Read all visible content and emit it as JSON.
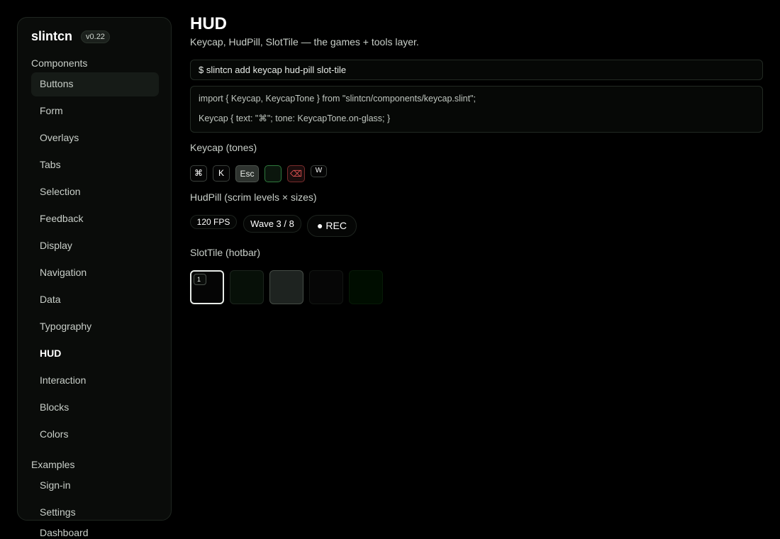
{
  "sidebar": {
    "brand": "slintcn",
    "version": "v0.22",
    "components_label": "Components",
    "components": [
      "Buttons",
      "Form",
      "Overlays",
      "Tabs",
      "Selection",
      "Feedback",
      "Display",
      "Navigation",
      "Data",
      "Typography",
      "HUD",
      "Interaction",
      "Blocks",
      "Colors"
    ],
    "active_item": "HUD",
    "hovered_item": "Buttons",
    "examples_label": "Examples",
    "examples": [
      "Sign-in",
      "Settings",
      "Dashboard"
    ]
  },
  "main": {
    "title": "HUD",
    "subtitle": "Keycap, HudPill, SlotTile — the games + tools layer.",
    "install_command": "$ slintcn add keycap hud-pill slot-tile",
    "code_lines": [
      "import { Keycap, KeycapTone } from \"slintcn/components/keycap.slint\";",
      "Keycap { text: \"⌘\"; tone: KeycapTone.on-glass; }"
    ],
    "keycap_heading": "Keycap (tones)",
    "keycaps": [
      {
        "label": "⌘",
        "tone": "default"
      },
      {
        "label": "K",
        "tone": "default"
      },
      {
        "label": "Esc",
        "tone": "raised"
      },
      {
        "label": "",
        "tone": "accent"
      },
      {
        "label": "⌫",
        "tone": "danger",
        "icon": "backspace-icon"
      },
      {
        "label": "W",
        "tone": "small"
      }
    ],
    "hudpill_heading": "HudPill (scrim levels × sizes)",
    "pills": [
      {
        "label": "120 FPS",
        "size": "sm"
      },
      {
        "label": "Wave 3 / 8",
        "size": "md"
      },
      {
        "label": "● REC",
        "size": "lg"
      }
    ],
    "slottile_heading": "SlotTile (hotbar)",
    "slots": [
      {
        "badge": "1",
        "selected": true
      },
      {
        "badge": "",
        "selected": false
      },
      {
        "badge": "",
        "selected": false
      },
      {
        "badge": "",
        "selected": false
      },
      {
        "badge": "",
        "selected": false
      }
    ]
  },
  "colors": {
    "background": "#000000",
    "panel": "#0a0c0a",
    "accent_green": "#2f7a3d",
    "danger_red": "#e05252"
  }
}
